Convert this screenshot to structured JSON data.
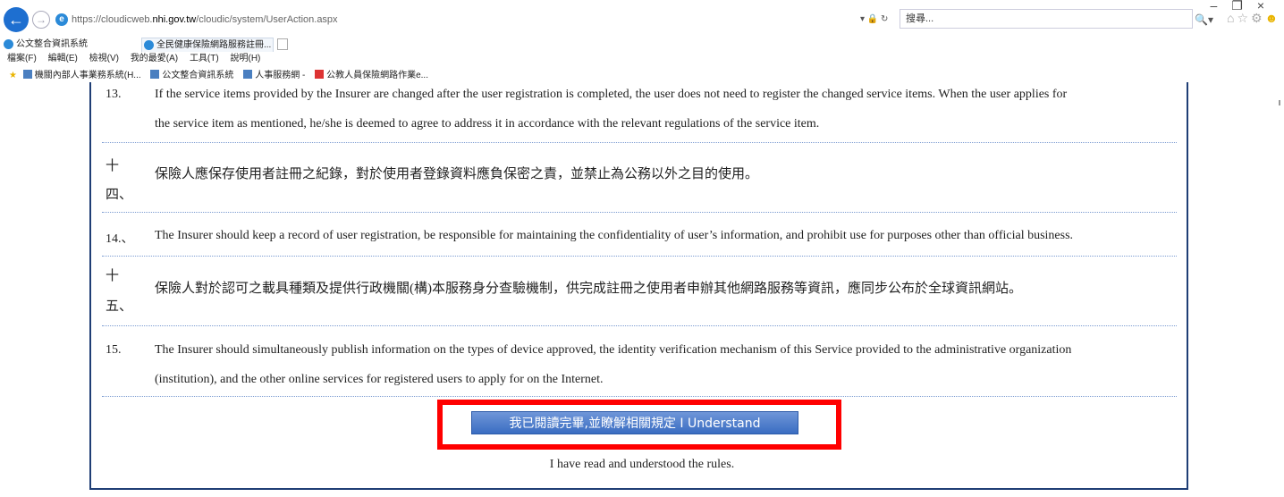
{
  "browser": {
    "address_prefix": "https://cloudicweb.",
    "address_host": "nhi.gov.tw",
    "address_path": "/cloudic/system/UserAction.aspx",
    "addr_tools": "▾ 🔒 ↻",
    "search_placeholder": "搜尋...",
    "search_button": "🔍▾",
    "tabs": [
      {
        "label": "公文整合資訊系統"
      },
      {
        "label": "全民健康保險網路服務註冊..."
      }
    ],
    "tab_close": "×",
    "menu": [
      "檔案(F)",
      "編輯(E)",
      "檢視(V)",
      "我的最愛(A)",
      "工具(T)",
      "說明(H)"
    ],
    "favorites": [
      "機關內部人事業務系統(H...",
      "公文整合資訊系統",
      "人事服務網 -",
      "公教人員保險網路作業e..."
    ]
  },
  "content": {
    "item13_num": "13.",
    "item13_line1": "If the service items provided by the Insurer are changed after the user registration is completed, the user does not need to register the changed service items. When the user applies for",
    "item13_line2": "the service item as mentioned, he/she is deemed to agree to address it in accordance with the relevant regulations of the service item.",
    "item14zh_num_a": "十",
    "item14zh_num_b": "四、",
    "item14zh_text": "保險人應保存使用者註冊之紀錄，對於使用者登錄資料應負保密之責，並禁止為公務以外之目的使用。",
    "item14_num": "14.、",
    "item14_text": "The Insurer should keep a record of user registration, be responsible for maintaining the confidentiality of user’s information, and prohibit use for purposes other than official business.",
    "item15zh_num_a": "十",
    "item15zh_num_b": "五、",
    "item15zh_text": "保險人對於認可之載具種類及提供行政機關(構)本服務身分查驗機制，供完成註冊之使用者申辦其他網路服務等資訊，應同步公布於全球資訊網站。",
    "item15_num": "15.",
    "item15_line1": "The Insurer should simultaneously publish information on the types of device approved, the identity verification mechanism of this Service provided to the administrative organization",
    "item15_line2": "(institution), and the other online services for registered users to apply for on the Internet.",
    "agree_button": "我已閱讀完畢,並瞭解相關規定 I Understand",
    "understood_text": "I have read and understood the rules."
  },
  "colors": {
    "frame_border": "#1f3e75",
    "button_bg": "#3a6dc2",
    "highlight": "#ff0000"
  }
}
